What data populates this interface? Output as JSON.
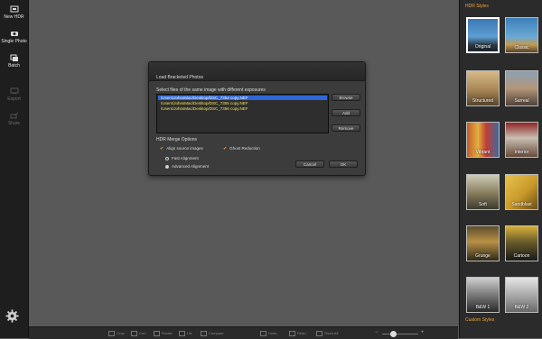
{
  "left_nav": {
    "items": [
      {
        "label": "New HDR",
        "icon": "new-hdr-icon"
      },
      {
        "label": "Single Photo",
        "icon": "single-photo-icon"
      },
      {
        "label": "Batch",
        "icon": "batch-icon"
      },
      {
        "label": "Export",
        "icon": "export-icon"
      },
      {
        "label": "Share",
        "icon": "share-icon"
      }
    ],
    "settings_icon": "gear-icon"
  },
  "dialog": {
    "title": "Load Bracketed Photos",
    "instructions": "Select files of the same image with different exposures",
    "files": [
      "/Users/JohnsMac/Desktop/DSC_7354 copy.NEF",
      "/Users/JohnsMac/Desktop/DSC_7355 copy.NEF",
      "/Users/JohnsMac/Desktop/DSC_7356 copy.NEF"
    ],
    "browse_label": "Browse",
    "add_label": "Add",
    "remove_label": "Remove",
    "merge_options_title": "HDR Merge Options",
    "align_label": "Align source images",
    "ghost_label": "Ghost Reduction",
    "fast_align_label": "Fast Alignment",
    "advanced_align_label": "Advanced Alignment",
    "cancel_label": "Cancel",
    "ok_label": "OK"
  },
  "styles_panel": {
    "title": "HDR Styles",
    "footer": "Custom Styles",
    "styles": [
      {
        "label": "Original"
      },
      {
        "label": "Classic"
      },
      {
        "label": "Structured"
      },
      {
        "label": "Surreal"
      },
      {
        "label": "Vibrant"
      },
      {
        "label": "Interior"
      },
      {
        "label": "Soft"
      },
      {
        "label": "Sandblast"
      },
      {
        "label": "Grunge"
      },
      {
        "label": "Cartoon"
      },
      {
        "label": "B&W 1"
      },
      {
        "label": "B&W 2"
      }
    ]
  },
  "toolbar": {
    "items": [
      {
        "label": "Crop"
      },
      {
        "label": "Curl"
      },
      {
        "label": "Rotate"
      },
      {
        "label": "Lift"
      },
      {
        "label": "Compare"
      },
      {
        "label": "Undo"
      },
      {
        "label": "Redo"
      },
      {
        "label": "Show All"
      }
    ]
  },
  "colors": {
    "accent": "#f0a43a",
    "selection": "#2f67d8",
    "file_text": "#f5e35a"
  }
}
